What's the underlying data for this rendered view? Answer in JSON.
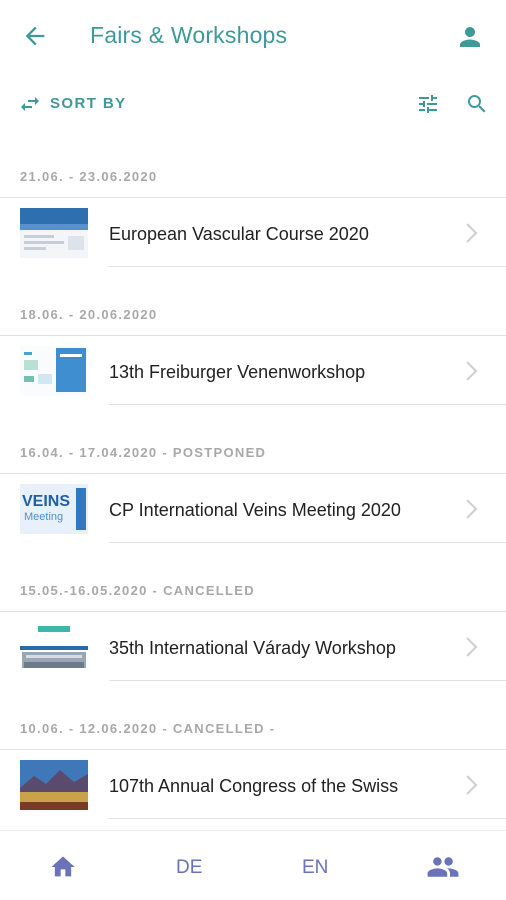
{
  "header": {
    "title": "Fairs & Workshops",
    "back_icon": "arrow-left-icon",
    "profile_icon": "person-icon"
  },
  "toolbar": {
    "sort_label": "SORT BY",
    "sort_icon": "swap-arrows-icon",
    "filter_icon": "sliders-icon",
    "search_icon": "search-icon"
  },
  "colors": {
    "accent": "#3d9a98",
    "nav": "#6a72b8",
    "section_text": "#a8a8a8"
  },
  "events": [
    {
      "date": "21.06. - 23.06.2020",
      "title": "European Vascular Course 2020"
    },
    {
      "date": "18.06. - 20.06.2020",
      "title": "13th Freiburger Venenworkshop"
    },
    {
      "date": "16.04. - 17.04.2020 - POSTPONED",
      "title": "CP International Veins Meeting 2020",
      "thumb_text": "VEINS",
      "thumb_subtext": "Meeting"
    },
    {
      "date": "15.05.-16.05.2020 - CANCELLED",
      "title": "35th International Várady Workshop"
    },
    {
      "date": "10.06. - 12.06.2020 - CANCELLED -",
      "title": "107th Annual Congress of the Swiss"
    }
  ],
  "bottom_nav": {
    "home_icon": "home-icon",
    "lang_de": "DE",
    "lang_en": "EN",
    "people_icon": "people-icon"
  }
}
